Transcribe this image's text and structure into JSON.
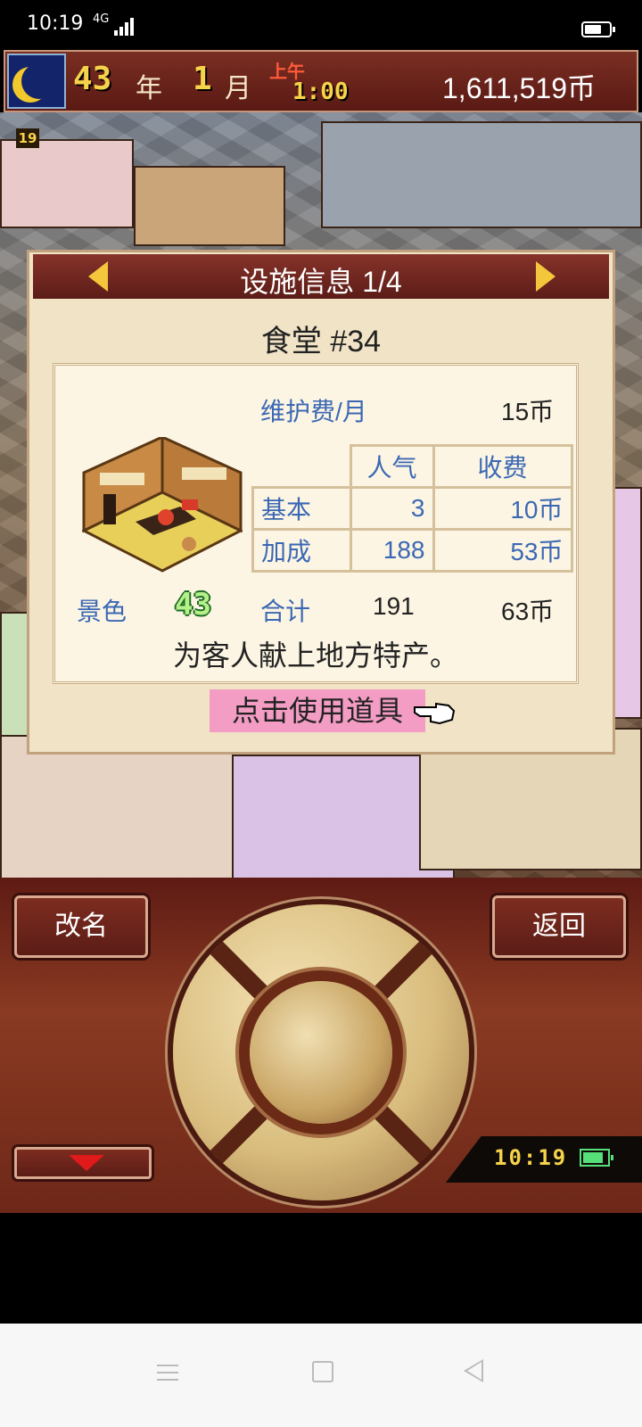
{
  "status_bar": {
    "time": "10:19",
    "network": "4G"
  },
  "hud": {
    "year_num": "43",
    "year_unit": "年",
    "month_num": "1",
    "month_unit": "月",
    "ampm": "上午",
    "clock": "1:00",
    "money": "1,611,519币"
  },
  "map": {
    "floor_badge": "19"
  },
  "dialog": {
    "title": "设施信息 1/4",
    "facility_name": "食堂 #34",
    "maintenance_label": "维护费/月",
    "maintenance_value": "15币",
    "table": {
      "headers": [
        "人气",
        "收费"
      ],
      "rows": [
        {
          "label": "基本",
          "popularity": "3",
          "fee": "10币"
        },
        {
          "label": "加成",
          "popularity": "188",
          "fee": "53币"
        }
      ]
    },
    "scenery_label": "景色",
    "scenery_value": "43",
    "total_label": "合计",
    "total_popularity": "191",
    "total_fee": "63币",
    "description": "为客人献上地方特产。",
    "use_item": "点击使用道具"
  },
  "panel": {
    "rename": "改名",
    "back": "返回",
    "mini_time": "10:19"
  }
}
